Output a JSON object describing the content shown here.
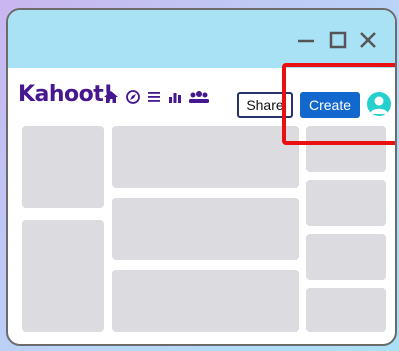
{
  "window": {
    "controls": {
      "minimize_icon": "minimize-icon",
      "maximize_icon": "maximize-icon",
      "close_icon": "close-icon"
    }
  },
  "navbar": {
    "logo_text": "Kahoot!",
    "nav_icons": [
      "home-icon",
      "discover-icon",
      "library-icon",
      "reports-icon",
      "groups-icon"
    ],
    "share_label": "Share",
    "create_label": "Create",
    "avatar_icon": "user-avatar-icon"
  },
  "colors": {
    "titlebar": "#a9e2f5",
    "logo": "#46178f",
    "create_button": "#1368ce",
    "avatar": "#26d0ce",
    "placeholder": "#dcdce0",
    "highlight": "#e81010"
  }
}
